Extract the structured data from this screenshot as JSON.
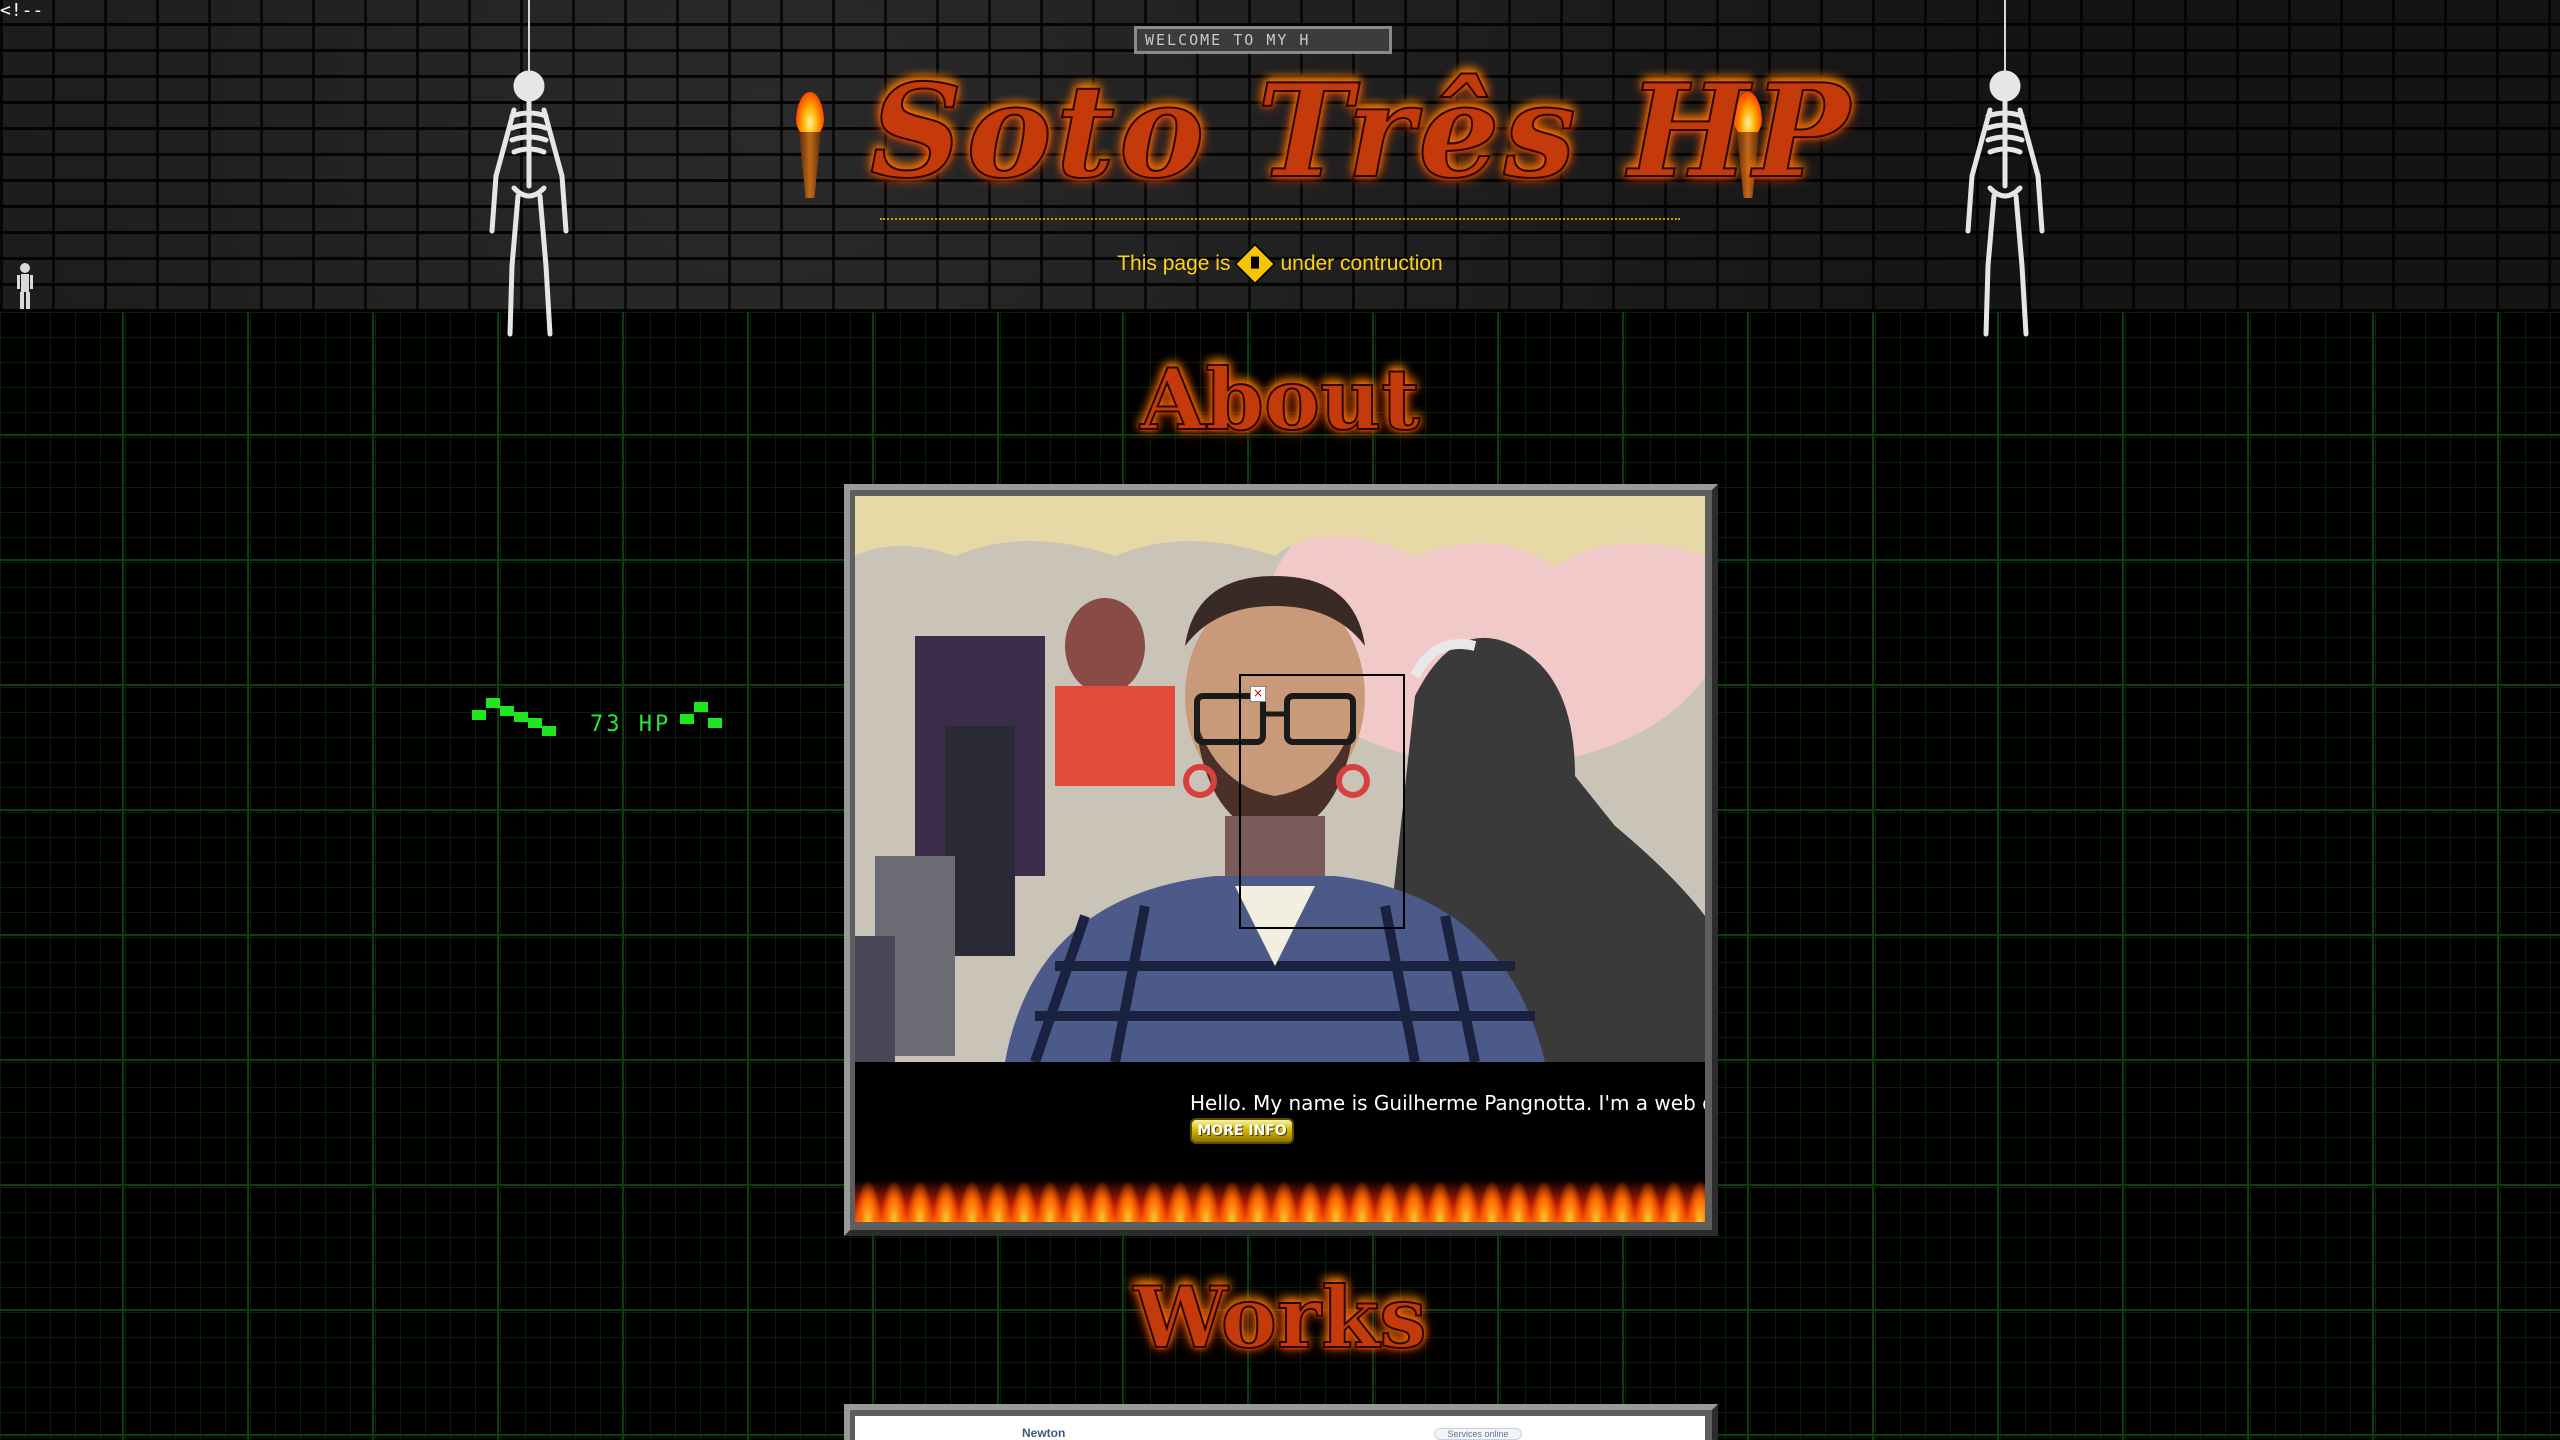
{
  "comment_text": "<!--",
  "welcome_marquee": "WELCOME TO MY H",
  "site_title": "Soto Três HP",
  "construction": {
    "before": "This page is",
    "after": "under contruction"
  },
  "about": {
    "title": "About",
    "bio": "Hello. My name is Guilherme Pangnotta. I'm a web devel",
    "more_info_label": "MORE INFO"
  },
  "hit_counter": {
    "label": "73 HP"
  },
  "works": {
    "title": "Works",
    "preview_brand": "Newton",
    "preview_pill": "Services online"
  },
  "colors": {
    "grid_line": "#0f3d12",
    "title_fire": "#c43a0a",
    "construction_text": "#ffd21a",
    "hp_green": "#26e63c"
  }
}
